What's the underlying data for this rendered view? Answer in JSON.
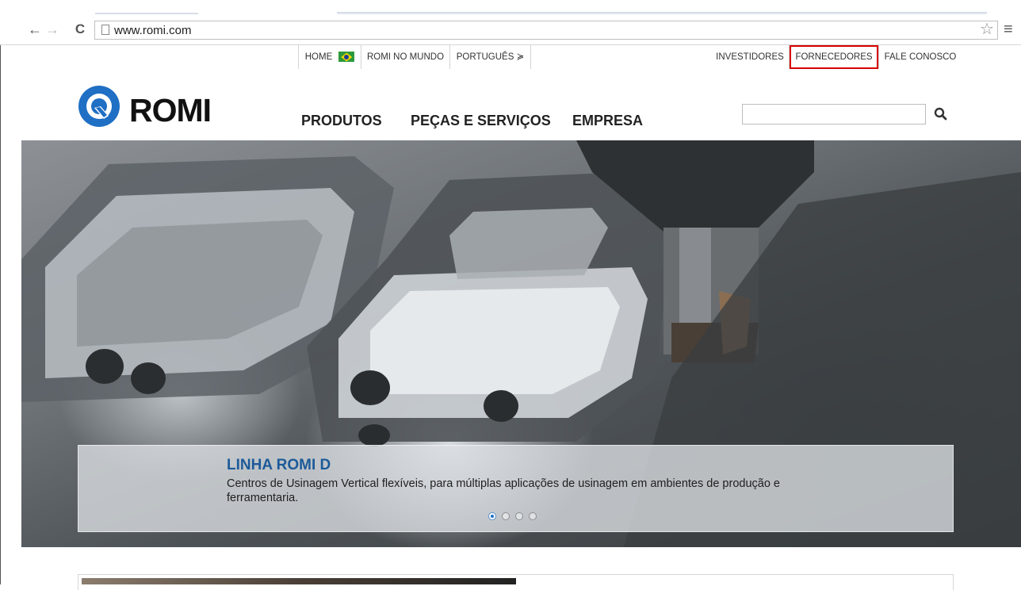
{
  "browser": {
    "url": "www.romi.com",
    "back_glyph": "←",
    "forward_glyph": "→",
    "reload_glyph": "C",
    "bookmark_glyph": "☆",
    "menu_glyph": "≡"
  },
  "top_nav": {
    "home": "HOME",
    "romi_no_mundo": "ROMI NO MUNDO",
    "language": "PORTUGUÊS ≽",
    "investidores": "INVESTIDORES",
    "fornecedores": "FORNECEDORES",
    "fale_conosco": "FALE CONOSCO"
  },
  "header": {
    "logo_text": "ROMI",
    "nav": {
      "produtos": "PRODUTOS",
      "pecas": "PEÇAS E SERVIÇOS",
      "empresa": "EMPRESA"
    },
    "search_value": ""
  },
  "hero": {
    "title": "LINHA ROMI D",
    "description": "Centros de Usinagem Vertical flexíveis, para múltiplas aplicações de usinagem em ambientes de produção e ferramentaria.",
    "slides_total": 4,
    "active_slide": 1
  },
  "colors": {
    "brand_blue": "#1d5a99",
    "logo_blue": "#1f6fc4",
    "highlight_red": "#d60000"
  },
  "icons": [
    "back-arrow-icon",
    "forward-arrow-icon",
    "reload-icon",
    "page-icon",
    "star-icon",
    "menu-icon",
    "brazil-flag-icon",
    "search-icon",
    "romi-logo-icon"
  ]
}
